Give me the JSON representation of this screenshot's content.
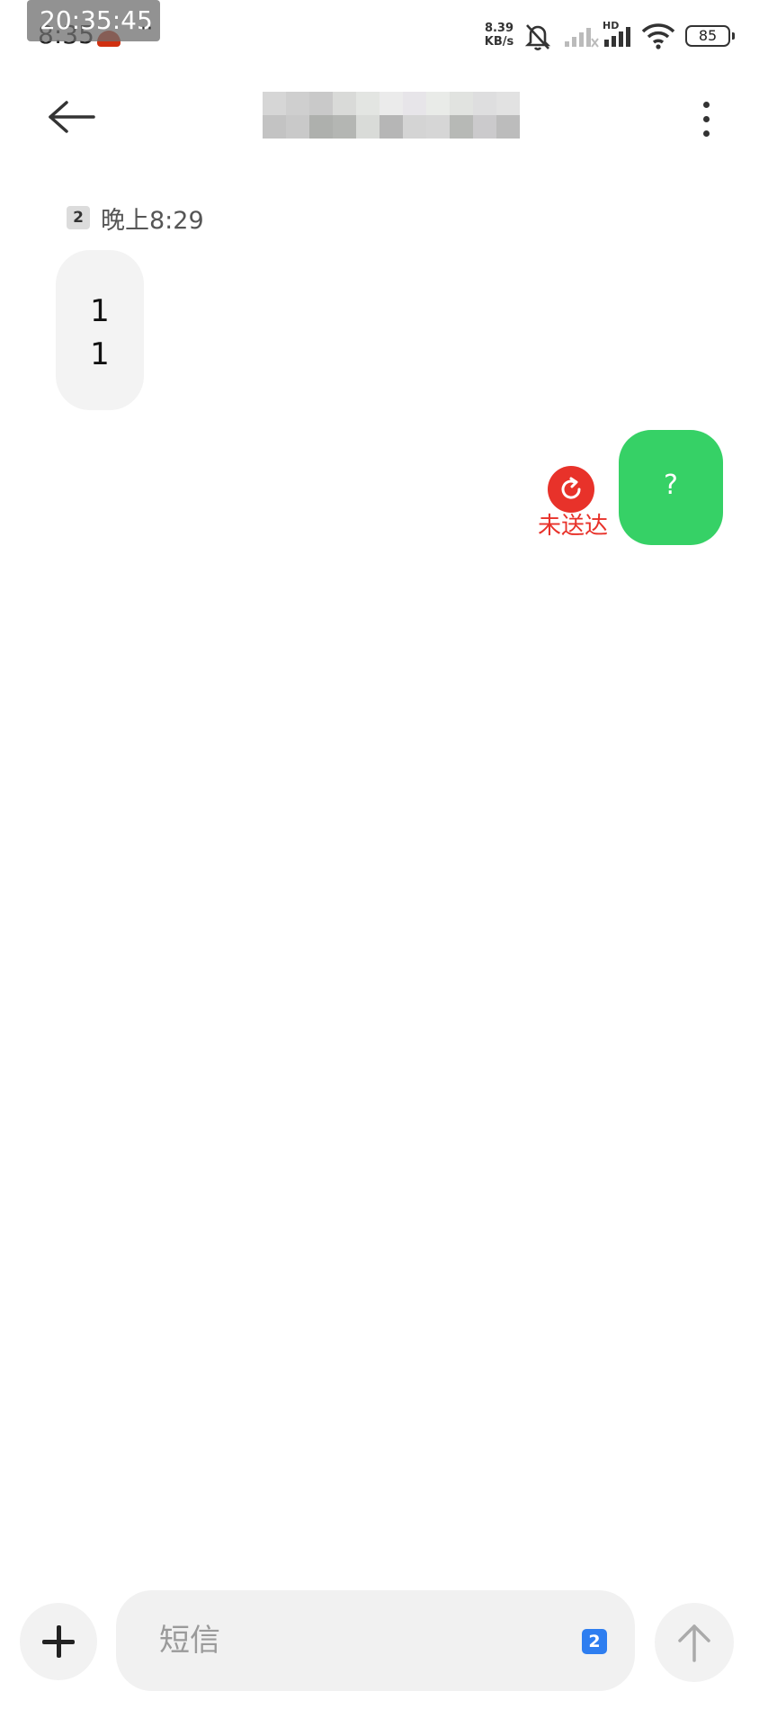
{
  "status_bar": {
    "overlay_clock": "20:35:45",
    "time": "8:35",
    "dots": "··",
    "net_speed_value": "8.39",
    "net_speed_unit": "KB/s",
    "signal_label": "HD",
    "battery": "85"
  },
  "header": {
    "contact_name": ""
  },
  "conversation": {
    "incoming": {
      "sim_slot": "2",
      "time": "晚上8:29",
      "text": "1\n1"
    },
    "outgoing": {
      "text": "?",
      "status": "未送达",
      "status_color": "#e8322a",
      "bubble_color": "#36d166"
    }
  },
  "composer": {
    "placeholder": "短信",
    "sim_slot": "2",
    "sim_color": "#2e7ef0"
  }
}
